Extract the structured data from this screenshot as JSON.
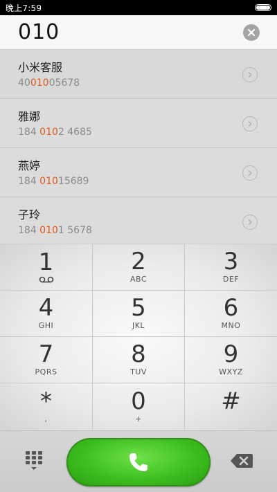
{
  "status_bar": {
    "time": "晚上7:59",
    "battery_level": 1.0
  },
  "dialer": {
    "number": "010",
    "clear_icon": "clear-icon"
  },
  "contacts": [
    {
      "name": "小米客服",
      "number_parts": [
        "40",
        "010",
        "05678"
      ]
    },
    {
      "name": "雅娜",
      "number_parts": [
        "184 ",
        "010",
        "2 4685"
      ]
    },
    {
      "name": "燕婷",
      "number_parts": [
        "184 ",
        "010",
        "15689"
      ]
    },
    {
      "name": "子玲",
      "number_parts": [
        "184 ",
        "010",
        "1 5678"
      ]
    }
  ],
  "keypad": [
    {
      "digit": "1",
      "sub": "",
      "sub_icon": "voicemail-icon"
    },
    {
      "digit": "2",
      "sub": "ABC"
    },
    {
      "digit": "3",
      "sub": "DEF"
    },
    {
      "digit": "4",
      "sub": "GHI"
    },
    {
      "digit": "5",
      "sub": "JKL"
    },
    {
      "digit": "6",
      "sub": "MNO"
    },
    {
      "digit": "7",
      "sub": "PQRS"
    },
    {
      "digit": "8",
      "sub": "TUV"
    },
    {
      "digit": "9",
      "sub": "WXYZ"
    },
    {
      "digit": "*",
      "sub": ","
    },
    {
      "digit": "0",
      "sub": "+"
    },
    {
      "digit": "#",
      "sub": ""
    }
  ],
  "colors": {
    "highlight": "#e05a1a",
    "call_green": "#3cbf1e"
  }
}
